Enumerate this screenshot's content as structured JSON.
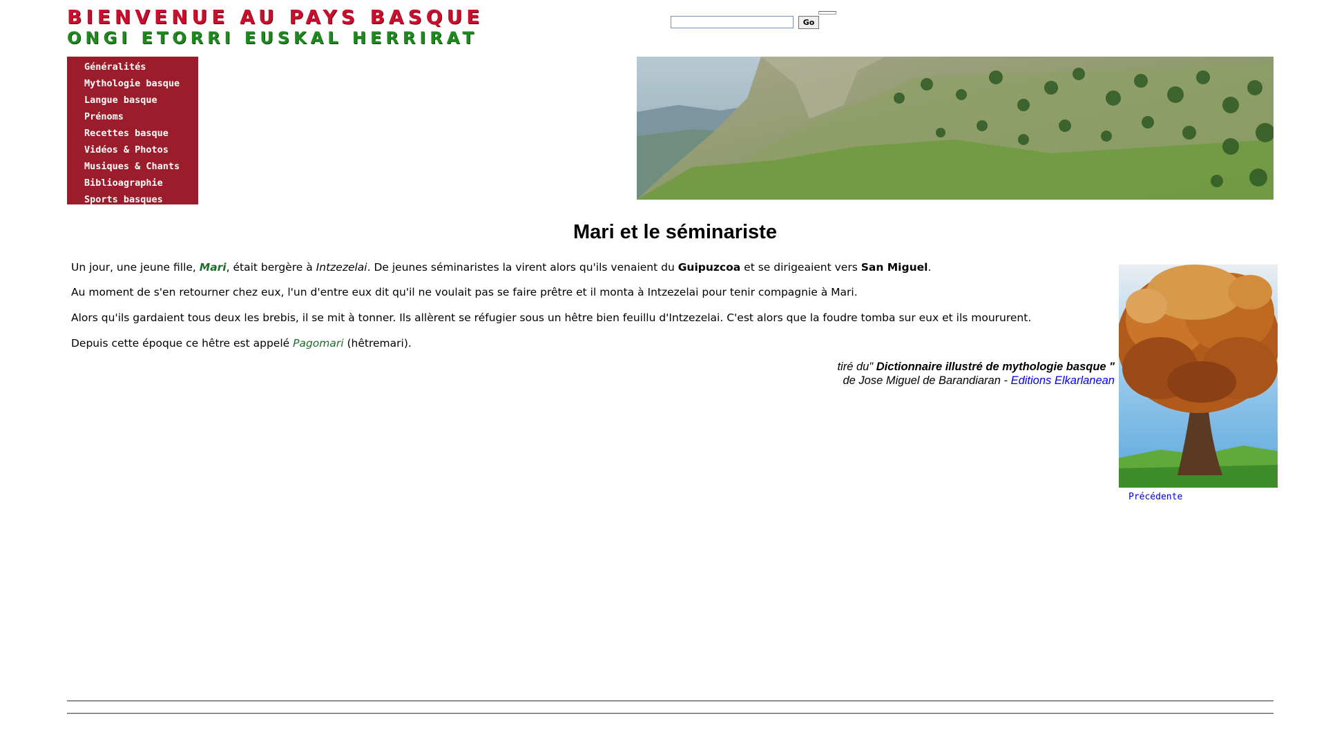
{
  "header": {
    "logo_line1": "BIENVENUE AU PAYS BASQUE",
    "logo_line2": "ONGI ETORRI EUSKAL HERRIRAT"
  },
  "search": {
    "value": "",
    "button_label": "Go"
  },
  "menu": {
    "items": [
      "Généralités",
      "Mythologie basque",
      "Langue basque",
      "Prénoms",
      "Recettes basque",
      "Vidéos & Photos",
      "Musiques & Chants",
      "Biblioagraphie",
      "Sports basques"
    ]
  },
  "article": {
    "title": "Mari et le séminariste",
    "p1": {
      "before": "Un jour, une jeune fille, ",
      "mari": "Mari",
      "mid1": ", était bergère à ",
      "place": "Intzezelai",
      "mid2": ". De jeunes séminaristes la virent alors qu'ils venaient du ",
      "region": "Guipuzcoa",
      "mid3": " et se dirigeaient vers ",
      "dest": "San Miguel",
      "end": "."
    },
    "p2": "Au moment de s'en retourner chez eux, l'un d'entre eux dit qu'il ne voulait pas se faire prêtre et il monta à Intzezelai pour tenir compagnie à Mari.",
    "p3": "Alors qu'ils gardaient tous deux les brebis, il se mit à tonner. Ils allèrent se réfugier sous un hêtre bien feuillu d'Intzezelai. C'est alors que la foudre tomba sur eux et ils moururent.",
    "p4": {
      "before": "Depuis cette époque ce hêtre est appelé ",
      "name": "Pagomari",
      "after": " (hêtremari)."
    },
    "citation": {
      "prefix": "tiré du\" ",
      "book": "Dictionnaire illustré de mythologie basque \"",
      "author": "de Jose Miguel de Barandiaran - ",
      "publisher": "Editions Elkarlanean"
    }
  },
  "nav": {
    "previous": "Précédente"
  },
  "colors": {
    "menu_bg": "#9b1c2a",
    "logo_red": "#c8102e",
    "logo_green": "#1e8a1e",
    "text_green": "#1f6b2a",
    "link_blue": "#0000ee"
  }
}
